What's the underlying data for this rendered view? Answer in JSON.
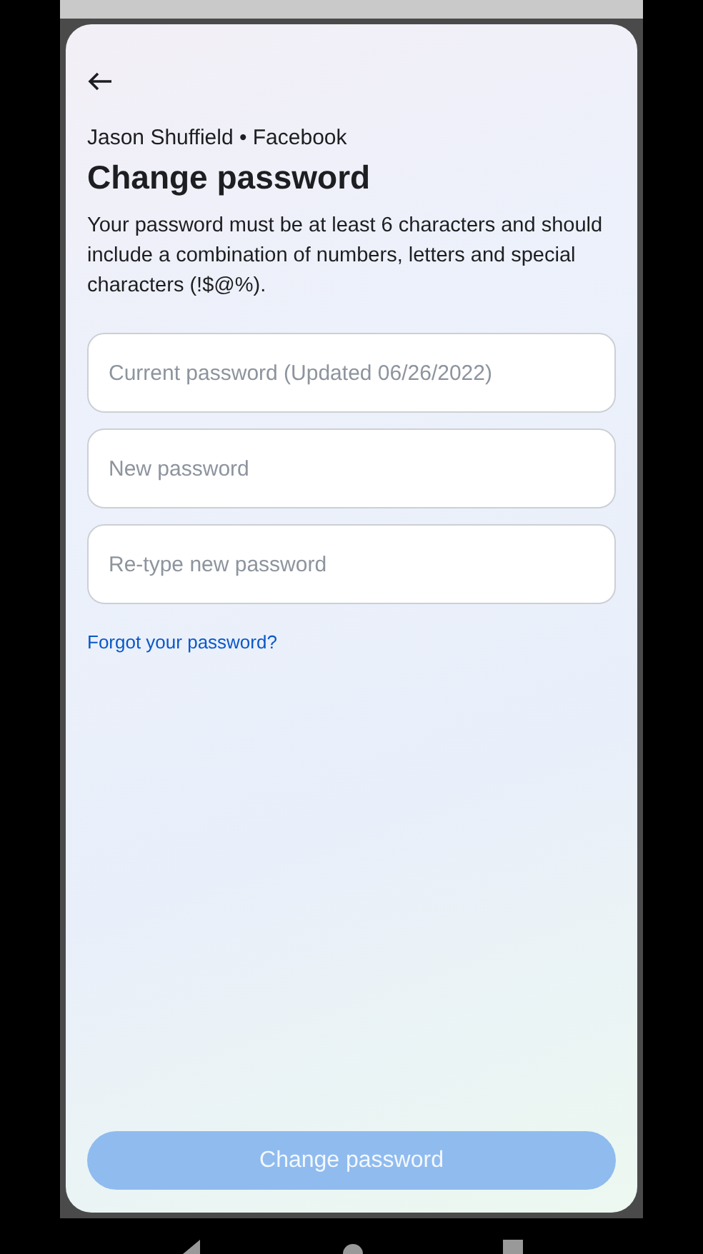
{
  "header": {
    "account": "Jason Shuffield • Facebook",
    "title": "Change password",
    "description": "Your password must be at least 6 characters and should include a combination of numbers, letters and special characters (!$@%)."
  },
  "fields": [
    {
      "placeholder": "Current password (Updated 06/26/2022)"
    },
    {
      "placeholder": "New password"
    },
    {
      "placeholder": "Re-type new password"
    }
  ],
  "forgot_link": "Forgot your password?",
  "submit": {
    "label": "Change password",
    "disabled": true
  }
}
